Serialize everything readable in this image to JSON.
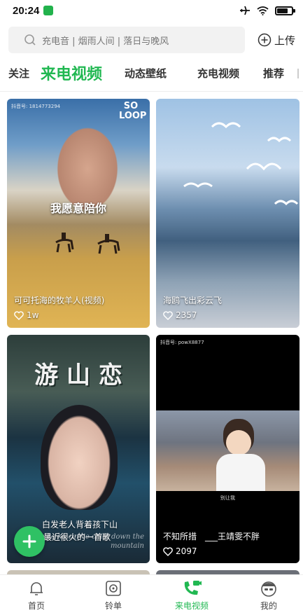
{
  "status": {
    "time": "20:24",
    "battery_level": 0.75
  },
  "search": {
    "placeholder": "充电音 | 烟雨人间 | 落日与晚风"
  },
  "upload": {
    "label": "上传"
  },
  "tabs": [
    "关注",
    "来电视频",
    "动态壁纸",
    "充电视频",
    "推荐"
  ],
  "active_tab": 1,
  "cards": [
    {
      "title": "可可托海的牧羊人(视频)",
      "likes": "1w",
      "overlay": "我愿意陪你",
      "watermark": "抖音号: 1814773294",
      "logo": "SO LOOP"
    },
    {
      "title": "海鸥飞出彩云飞",
      "likes": "2357"
    },
    {
      "title": "白发老人背着孩下山",
      "subtitle": "最近很火的一首歌",
      "likes": "",
      "poster_text": "游 山 恋",
      "english_lyric": "Ma ka ka carrie child down the mountain"
    },
    {
      "title": "不知所措　___王靖雯不胖",
      "likes": "2097",
      "watermark": "抖音号: powX8877",
      "caption": "别让我"
    }
  ],
  "nav": [
    {
      "label": "首页",
      "icon": "bell-icon"
    },
    {
      "label": "铃单",
      "icon": "playlist-icon"
    },
    {
      "label": "来电视频",
      "icon": "phone-video-icon"
    },
    {
      "label": "我的",
      "icon": "profile-icon"
    }
  ],
  "colors": {
    "accent": "#21b852",
    "fab": "#2fc164"
  }
}
